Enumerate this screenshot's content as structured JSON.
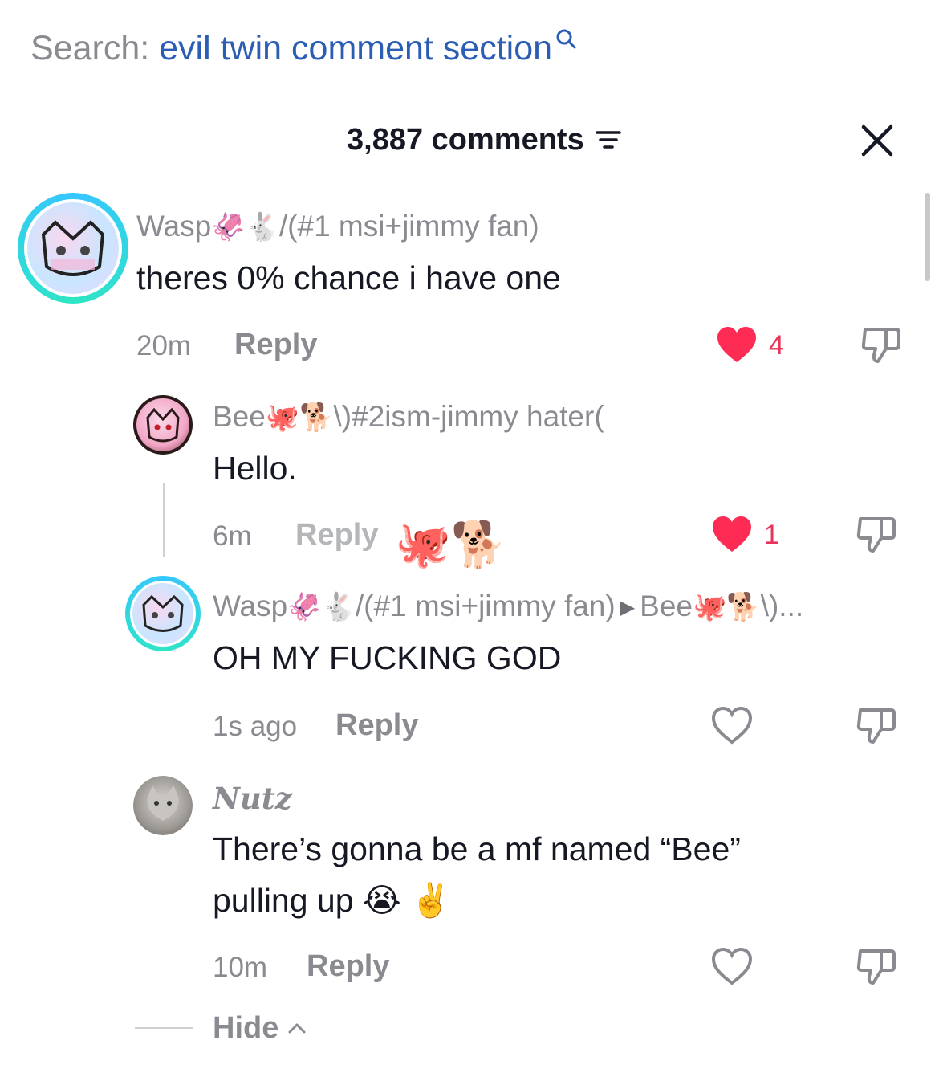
{
  "search": {
    "prefix": "Search: ",
    "query": "evil twin comment section"
  },
  "header": {
    "comment_count": "3,887 comments"
  },
  "comments": [
    {
      "username": "Wasp",
      "username_emojis": "🦑🐇",
      "username_suffix": "/(#1 msi+jimmy fan)",
      "text": "theres 0% chance i have one",
      "time": "20m",
      "reply_label": "Reply",
      "likes": "4",
      "liked": true
    },
    {
      "username": "Bee",
      "username_emojis": "🐙🐕",
      "username_suffix": "\\)#2ism-jimmy hater(",
      "text": "Hello.",
      "time": "6m",
      "reply_label": "Reply",
      "likes": "1",
      "liked": true,
      "stickers": "🐙🐕"
    },
    {
      "username": "Wasp",
      "username_emojis": "🦑🐇",
      "username_suffix": "/(#1 msi+jimmy fan)",
      "reply_to": "Bee",
      "reply_to_emojis": "🐙🐕",
      "reply_to_suffix": "\\)...",
      "text": "OH MY FUCKING GOD",
      "time": "1s ago",
      "reply_label": "Reply",
      "liked": false
    },
    {
      "username": "Nutz",
      "text_line1": "There’s gonna be a mf named “Bee”",
      "text_line2": "pulling up 😭 ✌️",
      "time": "10m",
      "reply_label": "Reply",
      "liked": false
    }
  ],
  "footer": {
    "hide_label": "Hide"
  },
  "colors": {
    "accent_like": "#fe2c55",
    "link": "#2b5db5",
    "muted": "#8a8b91"
  },
  "icons": [
    "search-icon",
    "filter-icon",
    "close-icon",
    "heart-icon",
    "dislike-icon",
    "chevron-up-icon"
  ]
}
